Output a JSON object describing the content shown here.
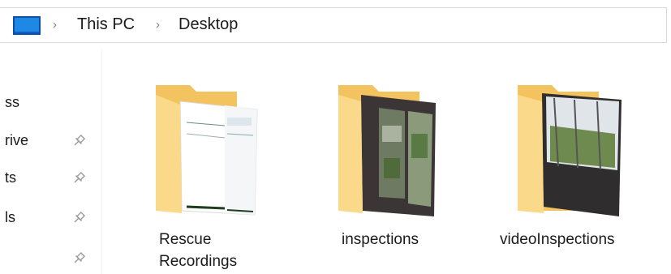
{
  "addressbar": {
    "breadcrumbs": [
      "This PC",
      "Desktop"
    ],
    "location_icon": "monitor-icon",
    "separator_icon": "chevron-right-icon"
  },
  "navpane": {
    "items": [
      {
        "label": "ss",
        "pinned": false
      },
      {
        "label": "rive",
        "pinned": true
      },
      {
        "label": "ts",
        "pinned": true
      },
      {
        "label": "ls",
        "pinned": true
      },
      {
        "label": "",
        "pinned": true
      }
    ],
    "pin_icon": "pin-icon"
  },
  "folders": [
    {
      "name": "Rescue Recordings",
      "line1": "Rescue",
      "line2": "Recordings",
      "icon": "folder-icon"
    },
    {
      "name": "inspections",
      "line1": "inspections",
      "line2": "",
      "icon": "folder-icon"
    },
    {
      "name": "videoInspections",
      "line1": "videoInspections",
      "line2": "",
      "icon": "folder-icon"
    }
  ],
  "colors": {
    "folder_back": "#f2c35e",
    "folder_front": "#fbd98a",
    "accent_blue": "#1e88e5"
  }
}
